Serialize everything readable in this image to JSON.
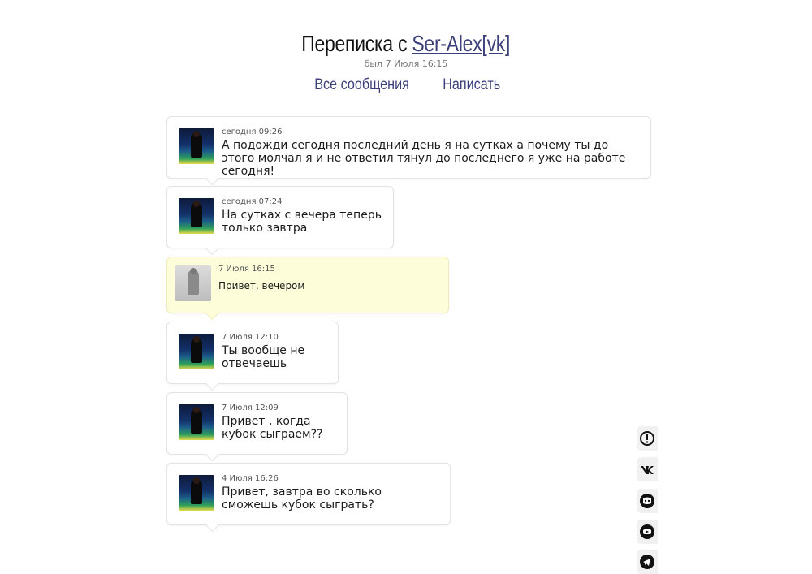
{
  "header": {
    "title_prefix": "Переписка с",
    "title_user": "Ser-Alex[vk]",
    "last_seen": "был 7 Июля 16:15"
  },
  "nav": {
    "all_messages": "Все сообщения",
    "write": "Написать"
  },
  "messages": [
    {
      "time": "сегодня 09:26",
      "text": "А подожди сегодня последний день я на сутках а почему ты до этого молчал я и не ответил тянул до последнего я уже на работе сегодня!"
    },
    {
      "time": "сегодня 07:24",
      "text": "На сутках с вечера теперь только завтра"
    },
    {
      "time": "7 Июля 16:15",
      "text": "Привет, вечером"
    },
    {
      "time": "7 Июля 12:10",
      "text": "Ты вообще не отвечаешь"
    },
    {
      "time": "7 Июля 12:09",
      "text": "Привет , когда кубок сыграем??"
    },
    {
      "time": "4 Июля 16:26",
      "text": "Привет, завтра во сколько сможешь кубок сыграть?"
    }
  ],
  "side_icons": [
    "report-icon",
    "vk-icon",
    "discord-icon",
    "youtube-icon",
    "telegram-icon"
  ]
}
